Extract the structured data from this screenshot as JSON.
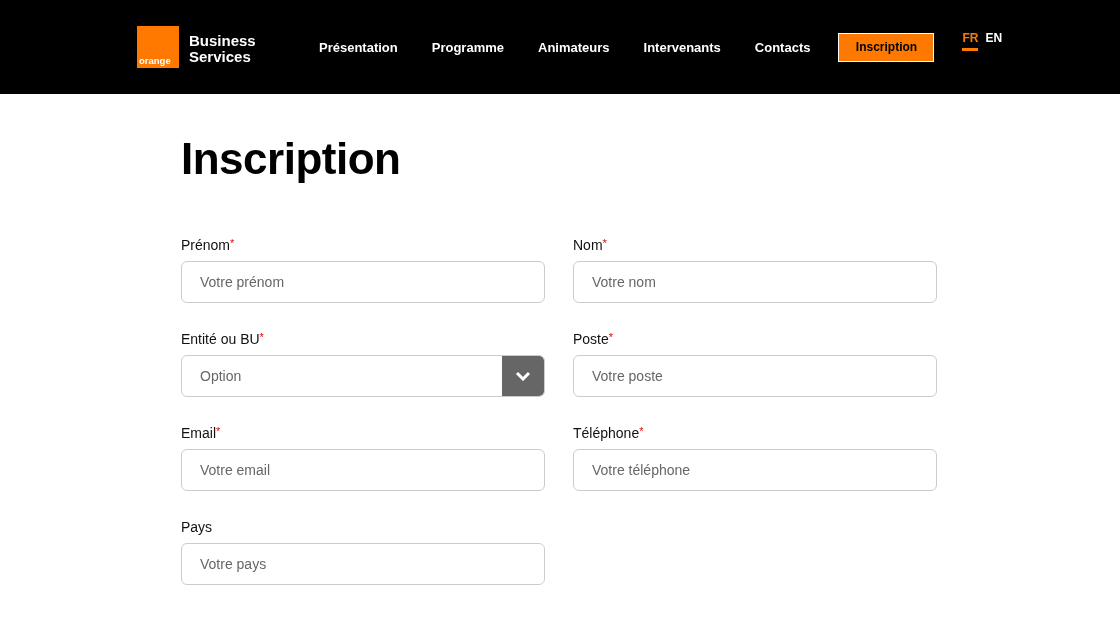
{
  "header": {
    "logo": {
      "badge": "orange",
      "name_lines": [
        "Business",
        "Services"
      ]
    },
    "nav": [
      {
        "label": "Présentation",
        "kind": "link"
      },
      {
        "label": "Programme",
        "kind": "link"
      },
      {
        "label": "Animateurs",
        "kind": "link"
      },
      {
        "label": "Intervenants",
        "kind": "link"
      },
      {
        "label": "Contacts",
        "kind": "link"
      },
      {
        "label": "Inscription",
        "kind": "cta"
      }
    ],
    "languages": [
      {
        "label": "FR",
        "selected": true
      },
      {
        "label": "EN",
        "selected": false
      }
    ]
  },
  "title": "Inscription",
  "fields": [
    {
      "kind": "text",
      "label": "Prénom",
      "required_mark": "*",
      "placeholder": "Votre prénom"
    },
    {
      "kind": "text",
      "label": "Nom",
      "required_mark": "*",
      "placeholder": "Votre nom"
    },
    {
      "kind": "select",
      "label": "Entité ou BU",
      "required_mark": "*",
      "placeholder": "Option"
    },
    {
      "kind": "text",
      "label": "Poste",
      "required_mark": "*",
      "placeholder": "Votre poste"
    },
    {
      "kind": "text",
      "label": "Email",
      "required_mark": "*",
      "placeholder": "Votre email"
    },
    {
      "kind": "text",
      "label": "Téléphone",
      "required_mark": "*",
      "placeholder": "Votre téléphone"
    },
    {
      "kind": "text",
      "label": "Pays",
      "placeholder": "Votre pays"
    }
  ]
}
